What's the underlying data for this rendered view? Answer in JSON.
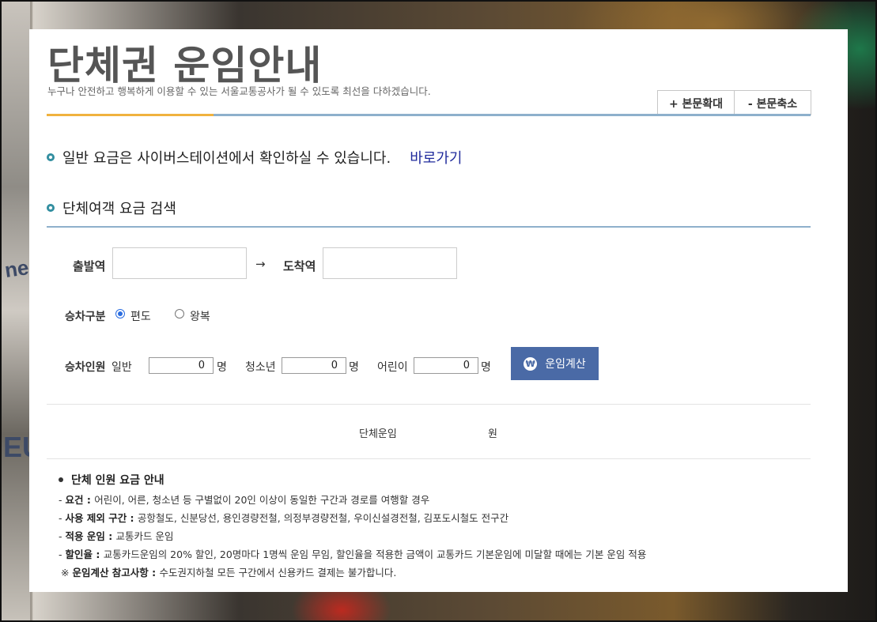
{
  "page": {
    "title": "단체권 운임안내",
    "subtitle": "누구나 안전하고 행복하게 이용할 수 있는 서울교통공사가 될 수 있도록 최선을 다하겠습니다."
  },
  "zoom": {
    "enlarge": "+ 본문확대",
    "reduce": "- 본문축소"
  },
  "notice": {
    "text": "일반 요금은 사이버스테이션에서 확인하실 수 있습니다.",
    "link": "바로가기"
  },
  "search": {
    "title": "단체여객 요금 검색",
    "departure_label": "출발역",
    "arrow": "→",
    "arrival_label": "도착역",
    "departure_value": "",
    "arrival_value": "",
    "trip_label": "승차구분",
    "trip_options": [
      "편도",
      "왕복"
    ],
    "trip_selected": "편도",
    "passengers_label": "승차인원",
    "adult_label": "일반",
    "adult_value": "0",
    "youth_label": "청소년",
    "youth_value": "0",
    "child_label": "어린이",
    "child_value": "0",
    "unit": "명",
    "calc_button": "운임계산",
    "won_symbol": "₩"
  },
  "result": {
    "label": "단체운임",
    "value": "",
    "unit": "원"
  },
  "info": {
    "title": "단체 인원 요금 안내",
    "items": [
      {
        "prefix": "- ",
        "key": "요건 : ",
        "text": "어린이, 어른, 청소년 등 구별없이 20인 이상이 동일한 구간과 경로를 여행할 경우"
      },
      {
        "prefix": "- ",
        "key": "사용 제외 구간 : ",
        "text": "공항철도, 신분당선, 용인경량전철, 의정부경량전철, 우이신설경전철, 김포도시철도 전구간"
      },
      {
        "prefix": "- ",
        "key": "적용 운임 : ",
        "text": "교통카드 운임"
      },
      {
        "prefix": "- ",
        "key": "할인율 : ",
        "text": "교통카드운임의 20% 할인, 20명마다 1명씩 운임 무임, 할인율을 적용한 금액이 교통카드 기본운임에 미달할 때에는 기본 운임 적용"
      },
      {
        "prefix": "※ ",
        "key": "운임계산 참고사항 : ",
        "text": "수도권지하철 모든 구간에서 신용카드 결제는 불가합니다."
      }
    ]
  },
  "background": {
    "text1": "ne",
    "text2": "EU"
  }
}
